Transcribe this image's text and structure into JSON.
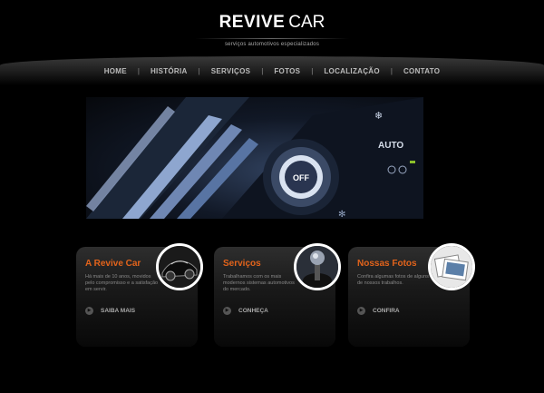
{
  "header": {
    "logo_bold": "REVIVE",
    "logo_normal": "CAR",
    "tagline": "serviços automotivos especializados"
  },
  "nav": {
    "items": [
      "HOME",
      "HISTÓRIA",
      "SERVIÇOS",
      "FOTOS",
      "LOCALIZAÇÃO",
      "CONTATO"
    ],
    "separator": "|"
  },
  "banner": {
    "labels": [
      "AUTO",
      "OFF"
    ]
  },
  "cards": [
    {
      "title": "A Revive Car",
      "text": "Há mais de 10 anos, movidos pelo compromisso e a satisfação em servir.",
      "link": "SAIBA MAIS",
      "thumb_icon": "car-photo-icon"
    },
    {
      "title": "Serviços",
      "text": "Trabalhamos com os mais modernos sistemas automotivos do mercado.",
      "link": "CONHEÇA",
      "thumb_icon": "gear-shift-photo-icon"
    },
    {
      "title": "Nossas Fotos",
      "text": "Confira algumas fotos de alguns de nossos trabalhos.",
      "link": "CONFIRA",
      "thumb_icon": "photos-icon"
    }
  ],
  "colors": {
    "accent": "#e2631b",
    "background": "#000000"
  }
}
